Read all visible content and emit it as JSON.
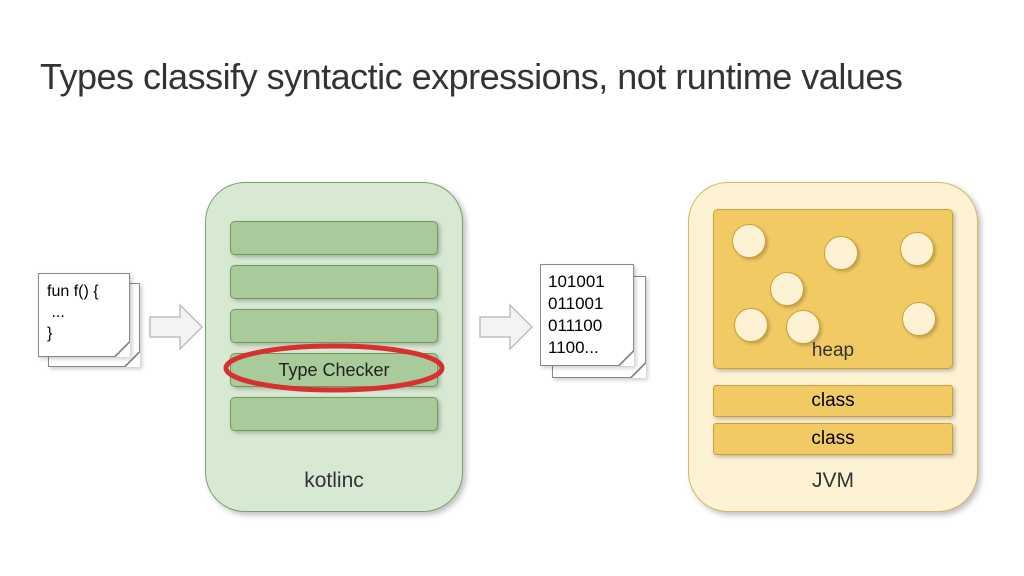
{
  "title": "Types classify syntactic expressions, not runtime values",
  "source": {
    "line1": "fun f() {",
    "line2": " ...",
    "line3": "}"
  },
  "compiler": {
    "label": "kotlinc",
    "phase_typechecker": "Type Checker"
  },
  "bytecode": {
    "l1": "101001",
    "l2": "011001",
    "l3": "011100",
    "l4": "1100..."
  },
  "jvm": {
    "label": "JVM",
    "heap_label": "heap",
    "class1": "class",
    "class2": "class"
  }
}
